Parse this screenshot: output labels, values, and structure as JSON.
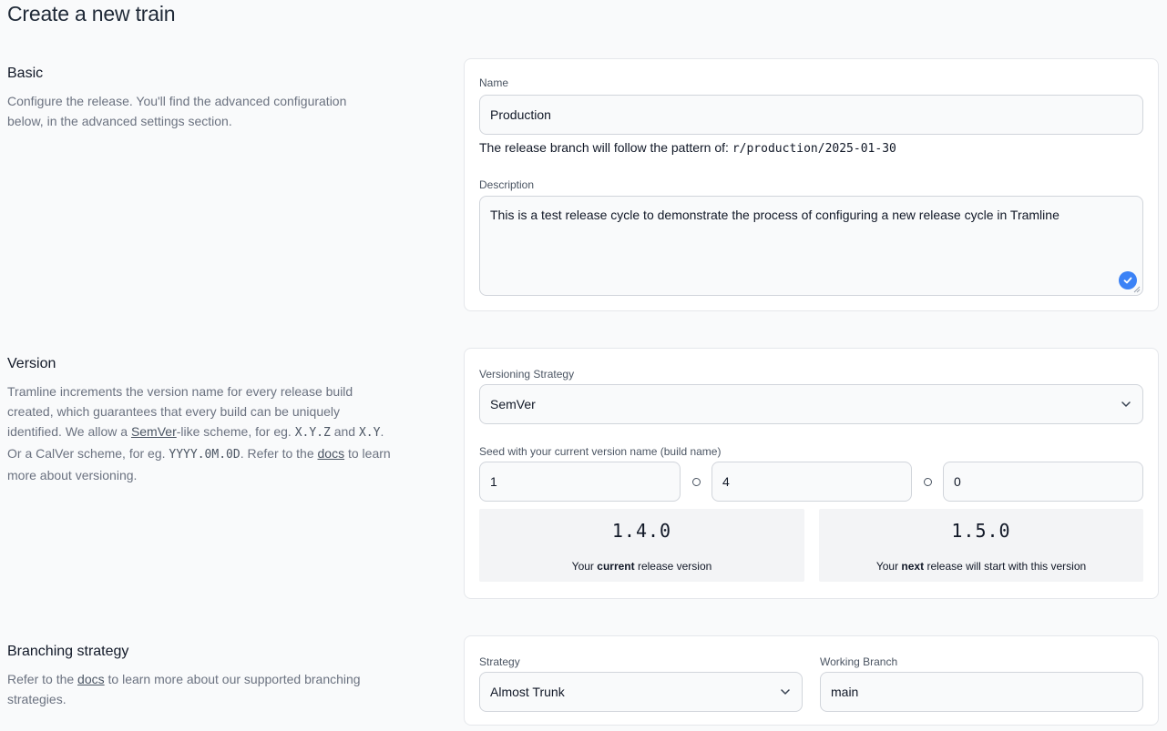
{
  "page": {
    "title": "Create a new train"
  },
  "basic": {
    "title": "Basic",
    "description": "Configure the release. You'll find the advanced configuration below, in the advanced settings section.",
    "name_label": "Name",
    "name_value": "Production",
    "branch_hint_prefix": "The release branch will follow the pattern of:",
    "branch_pattern": "r/production/2025-01-30",
    "description_label": "Description",
    "description_value": "This is a test release cycle to demonstrate the process of configuring a new release cycle in Tramline"
  },
  "version": {
    "title": "Version",
    "desc_1": "Tramline increments the version name for every release build created, which guarantees that every build can be uniquely identified. We allow a ",
    "semver_link": "SemVer",
    "desc_2": "-like scheme, for eg. ",
    "code_xyz": "X.Y.Z",
    "desc_and": " and ",
    "code_xy": "X.Y",
    "desc_3": ". Or a CalVer scheme, for eg. ",
    "code_calver": "YYYY.0M.0D",
    "desc_4": ". Refer to the ",
    "docs_link": "docs",
    "desc_5": " to learn more about versioning.",
    "strategy_label": "Versioning Strategy",
    "strategy_value": "SemVer",
    "seed_label": "Seed with your current version name (build name)",
    "major": "1",
    "minor": "4",
    "patch": "0",
    "current_version": "1.4.0",
    "current_caption_prefix": "Your ",
    "current_caption_bold": "current",
    "current_caption_suffix": " release version",
    "next_version": "1.5.0",
    "next_caption_prefix": "Your ",
    "next_caption_bold": "next",
    "next_caption_suffix": " release will start with this version"
  },
  "branching": {
    "title": "Branching strategy",
    "desc_1": "Refer to the ",
    "docs_link": "docs",
    "desc_2": " to learn more about our supported branching strategies.",
    "strategy_label": "Strategy",
    "strategy_value": "Almost Trunk",
    "working_branch_label": "Working Branch",
    "working_branch_value": "main"
  },
  "colors": {
    "check_accent": "#3b82f6",
    "card_border": "#e5e7eb",
    "muted_text": "#6b7280"
  },
  "icons": [
    "check-circle-icon",
    "chevron-down-icon",
    "resize-grip-icon",
    "dot-separator-icon"
  ]
}
